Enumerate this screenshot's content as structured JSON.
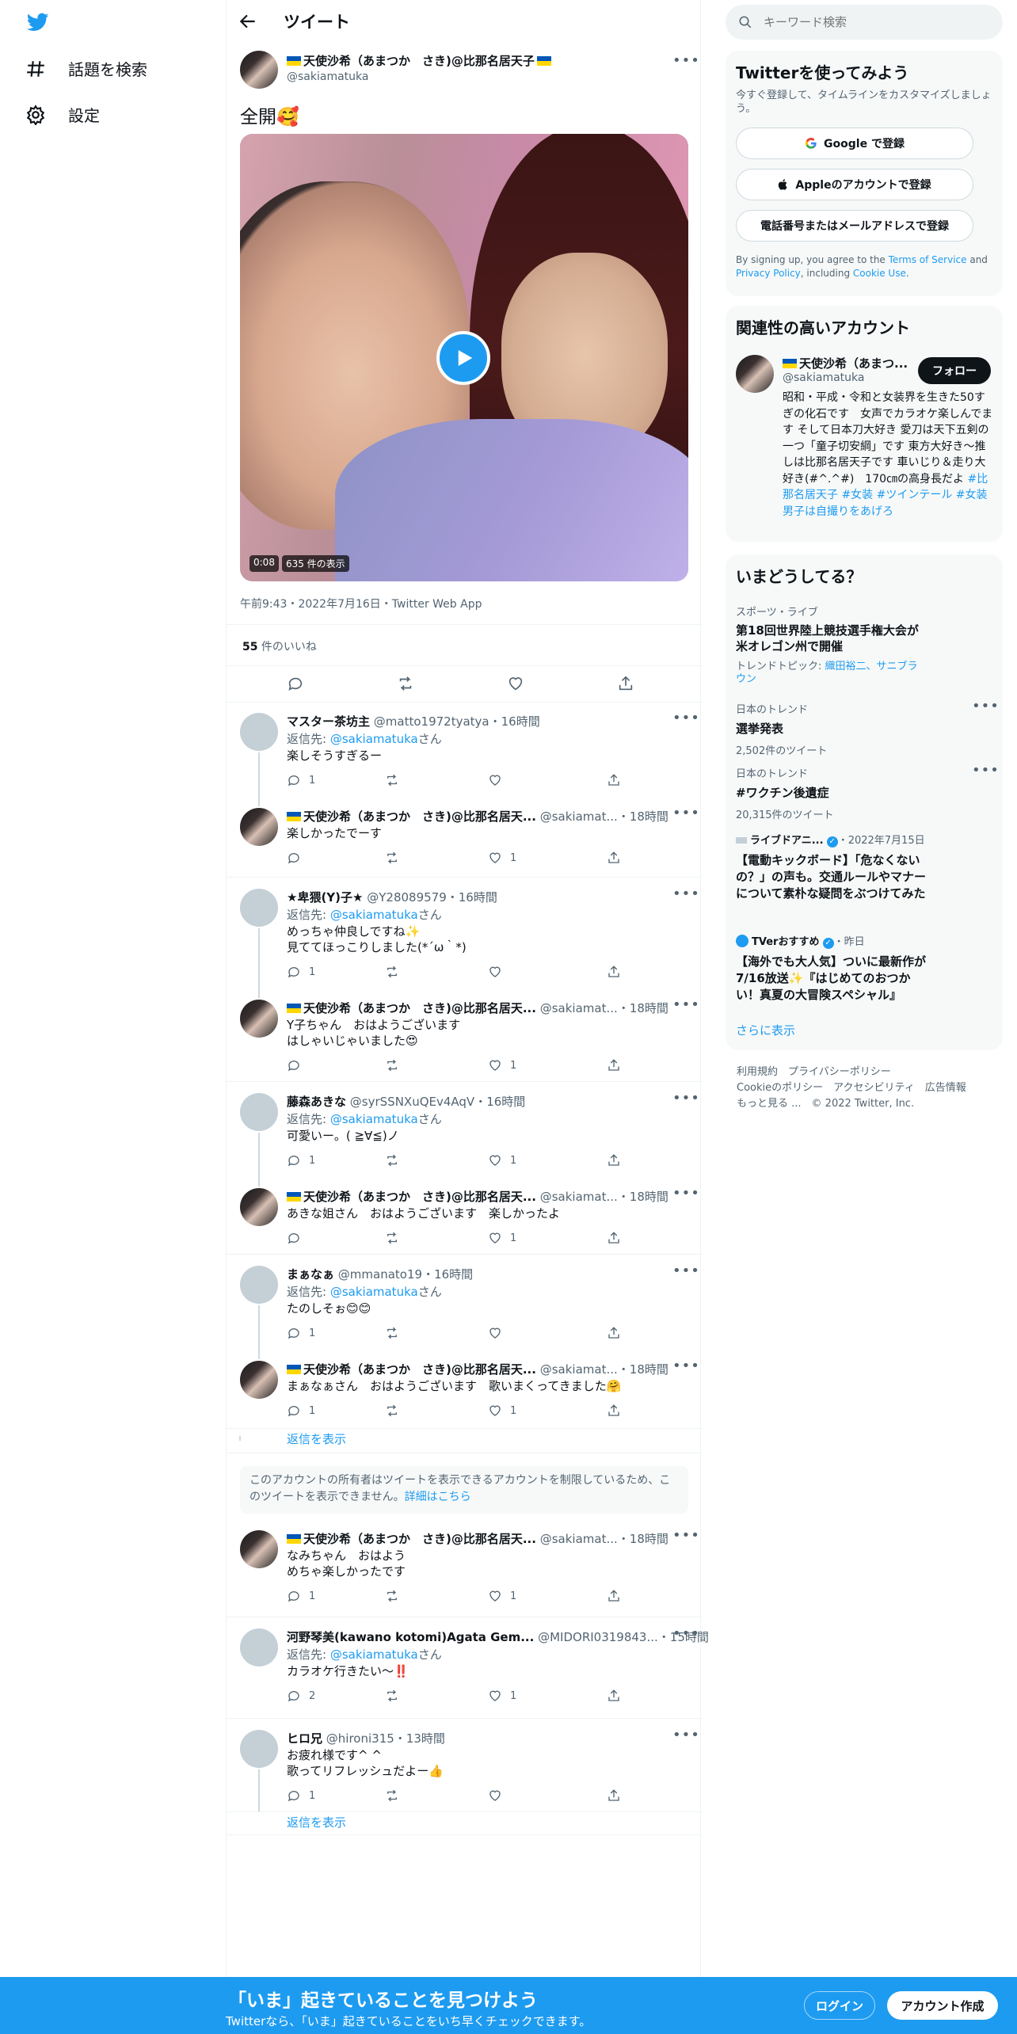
{
  "nav": {
    "explore": "話題を検索",
    "settings": "設定"
  },
  "header": {
    "title": "ツイート"
  },
  "tweet": {
    "name": "天使沙希（あまつか　さき)@比那名居天子",
    "handle": "@sakiamatuka",
    "text": "全開🥰",
    "video_duration": "0:08",
    "video_views": "635 件の表示",
    "meta": "午前9:43・2022年7月16日・Twitter Web App",
    "likes_count": "55",
    "likes_label": " 件のいいね"
  },
  "replies": [
    {
      "name": "マスター茶坊主",
      "handle": "@matto1972tyatya",
      "time": "・16時間",
      "reply_to_prefix": "返信先: ",
      "reply_to_handle": "@sakiamatuka",
      "reply_to_suffix": "さん",
      "text": "楽しそうすぎるー",
      "reply_count": "1",
      "like_count": ""
    },
    {
      "name": "天使沙希（あまつか　さき)@比那名居天...",
      "handle": "@sakiamat...",
      "time": "・18時間",
      "text": "楽しかったでーす",
      "reply_count": "",
      "like_count": "1"
    },
    {
      "name": "★卑猥(Y)子★",
      "handle": "@Y28089579",
      "time": "・16時間",
      "reply_to_prefix": "返信先: ",
      "reply_to_handle": "@sakiamatuka",
      "reply_to_suffix": "さん",
      "text": "めっちゃ仲良しですね✨\n見ててほっこりしました(*´ω｀*)",
      "reply_count": "1",
      "like_count": ""
    },
    {
      "name": "天使沙希（あまつか　さき)@比那名居天...",
      "handle": "@sakiamat...",
      "time": "・18時間",
      "text": "Y子ちゃん　おはようございます\nはしゃいじゃいました😍",
      "reply_count": "",
      "like_count": "1"
    },
    {
      "name": "藤森あきな",
      "handle": "@syrSSNXuQEv4AqV",
      "time": "・16時間",
      "reply_to_prefix": "返信先: ",
      "reply_to_handle": "@sakiamatuka",
      "reply_to_suffix": "さん",
      "text": "可愛いー。( ≧∀≦)ノ",
      "reply_count": "1",
      "like_count": "1"
    },
    {
      "name": "天使沙希（あまつか　さき)@比那名居天...",
      "handle": "@sakiamat...",
      "time": "・18時間",
      "text": "あきな姐さん　おはようございます　楽しかったよ",
      "reply_count": "",
      "like_count": "1"
    },
    {
      "name": "まぁなぁ",
      "handle": "@mmanato19",
      "time": "・16時間",
      "reply_to_prefix": "返信先: ",
      "reply_to_handle": "@sakiamatuka",
      "reply_to_suffix": "さん",
      "text": "たのしそぉ😊😊",
      "reply_count": "1",
      "like_count": ""
    },
    {
      "name": "天使沙希（あまつか　さき)@比那名居天...",
      "handle": "@sakiamat...",
      "time": "・18時間",
      "text": "まぁなぁさん　おはようございます　歌いまくってきました🤗",
      "reply_count": "1",
      "like_count": "1"
    },
    {
      "name": "天使沙希（あまつか　さき)@比那名居天...",
      "handle": "@sakiamat...",
      "time": "・18時間",
      "text": "なみちゃん　おはよう\nめちゃ楽しかったです",
      "reply_count": "1",
      "like_count": "1"
    },
    {
      "name": "河野琴美(kawano kotomi)Agata Gem...",
      "handle": "@MIDORI0319843...",
      "time": "・15時間",
      "reply_to_prefix": "返信先: ",
      "reply_to_handle": "@sakiamatuka",
      "reply_to_suffix": "さん",
      "text": "カラオケ行きたい～‼️",
      "reply_count": "2",
      "like_count": "1"
    },
    {
      "name": "ヒロ兄",
      "handle": "@hironi315",
      "time": "・13時間",
      "text": "お疲れ様です^ ^\n歌ってリフレッシュだよー👍",
      "reply_count": "1",
      "like_count": ""
    }
  ],
  "show_replies": "返信を表示",
  "restricted": {
    "text": "このアカウントの所有者はツイートを表示できるアカウントを制限しているため、このツイートを表示できません。",
    "link": "詳細はこちら"
  },
  "search": {
    "placeholder": "キーワード検索"
  },
  "signup_card": {
    "title": "Twitterを使ってみよう",
    "subtitle": "今すぐ登録して、タイムラインをカスタマイズしましょう。",
    "google": "Google で登録",
    "apple": "Appleのアカウントで登録",
    "phone": "電話番号またはメールアドレスで登録",
    "legal_1": "By signing up, you agree to the ",
    "terms": "Terms of Service",
    "legal_2": " and ",
    "privacy": "Privacy Policy",
    "legal_3": ", including ",
    "cookie": "Cookie Use",
    "legal_4": "."
  },
  "related": {
    "title": "関連性の高いアカウント",
    "name": "天使沙希（あまつ...",
    "handle": "@sakiamatuka",
    "follow": "フォロー",
    "bio": "昭和・平成・令和と女装界を生きた50すぎの化石です　女声でカラオケ楽しんでます そして日本刀大好き 愛刀は天下五剣の一つ「童子切安綱」です 東方大好き～推しは比那名居天子です 車いじり＆走り大好き(#^.^#)　170㎝の高身長だよ",
    "tags": "#比那名居天子 #女装 #ツインテール #女装男子は自撮りをあげろ"
  },
  "trends": {
    "title": "いまどうしてる？",
    "items": [
      {
        "context": "スポーツ・ライブ",
        "title": "第18回世界陸上競技選手権大会が米オレゴン州で開催",
        "extra_prefix": "トレンドトピック: ",
        "extra_link": "織田裕二、サニブラウン"
      },
      {
        "context": "日本のトレンド",
        "title": "選挙発表",
        "count": "2,502件のツイート"
      },
      {
        "context": "日本のトレンド",
        "title": "#ワクチン後遺症",
        "count": "20,315件のツイート"
      },
      {
        "source": "ライブドアニ...",
        "date": "・2022年7月15日",
        "title": "【電動キックボード】「危なくないの？」の声も。交通ルールやマナーについて素朴な疑問をぶつけてみた"
      },
      {
        "source": "TVerおすすめ",
        "date": "・昨日",
        "title": "【海外でも大人気】ついに最新作が7/16放送✨『はじめてのおつかい！真夏の大冒険スペシャル』"
      }
    ],
    "more": "さらに表示"
  },
  "footer_links": {
    "l1": "利用規約",
    "l2": "プライバシーポリシー",
    "l3": "Cookieのポリシー",
    "l4": "アクセシビリティ",
    "l5": "広告情報",
    "l6": "もっと見る ...",
    "l7": "© 2022 Twitter, Inc."
  },
  "bottom_bar": {
    "title": "「いま」起きていることを見つけよう",
    "subtitle": "Twitterなら、「いま」起きていることをいち早くチェックできます。",
    "login": "ログイン",
    "signup": "アカウント作成"
  },
  "colors": {
    "accent": "#1d9bf0",
    "text": "#0f1419",
    "secondary": "#536471"
  }
}
